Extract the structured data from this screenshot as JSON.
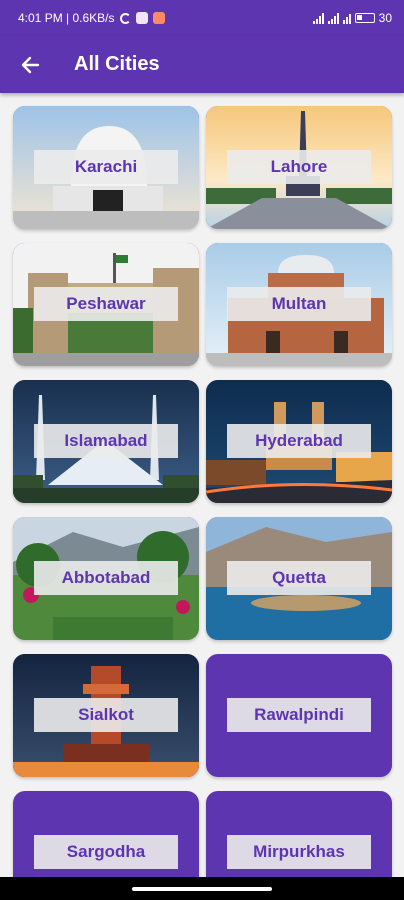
{
  "status_bar": {
    "left_text": "4:01 PM | 0.6KB/s",
    "battery": "30",
    "colors": {
      "bar": "#5e35b1"
    }
  },
  "app_bar": {
    "back_icon": "arrow-left-icon",
    "title": "All Cities"
  },
  "cities": [
    {
      "name": "Karachi"
    },
    {
      "name": "Lahore"
    },
    {
      "name": "Peshawar"
    },
    {
      "name": "Multan"
    },
    {
      "name": "Islamabad"
    },
    {
      "name": "Hyderabad"
    },
    {
      "name": "Abbotabad"
    },
    {
      "name": "Quetta"
    },
    {
      "name": "Sialkot"
    },
    {
      "name": "Rawalpindi"
    },
    {
      "name": "Sargodha"
    },
    {
      "name": "Mirpurkhas"
    }
  ],
  "theme": {
    "primary": "#5e35b1",
    "label_bg": "#ebebeb"
  }
}
